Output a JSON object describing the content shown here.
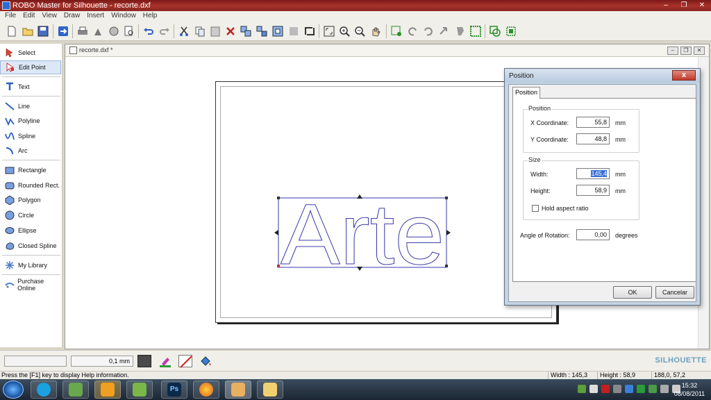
{
  "window": {
    "title": "ROBO Master for Silhouette - recorte.dxf",
    "controls": [
      "–",
      "❐",
      "✕"
    ]
  },
  "menu": [
    "File",
    "Edit",
    "View",
    "Draw",
    "Insert",
    "Window",
    "Help"
  ],
  "toolbox": [
    {
      "label": "Select",
      "icon": "select-arrow-icon"
    },
    {
      "label": "Edit Point",
      "icon": "edit-point-icon"
    },
    {
      "label": "Text",
      "icon": "text-icon"
    },
    {
      "label": "Line",
      "icon": "line-icon"
    },
    {
      "label": "Polyline",
      "icon": "polyline-icon"
    },
    {
      "label": "Spline",
      "icon": "spline-icon"
    },
    {
      "label": "Arc",
      "icon": "arc-icon"
    },
    {
      "label": "Rectangle",
      "icon": "rectangle-icon"
    },
    {
      "label": "Rounded Rect.",
      "icon": "rounded-rect-icon"
    },
    {
      "label": "Polygon",
      "icon": "polygon-icon"
    },
    {
      "label": "Circle",
      "icon": "circle-icon"
    },
    {
      "label": "Ellipse",
      "icon": "ellipse-icon"
    },
    {
      "label": "Closed Spline",
      "icon": "closed-spline-icon"
    },
    {
      "label": "My Library",
      "icon": "library-icon"
    },
    {
      "label": "Purchase Online",
      "icon": "purchase-icon"
    }
  ],
  "document": {
    "title": "recorte.dxf *",
    "artwork_text": "Arte"
  },
  "dialog": {
    "title": "Position",
    "close": "x",
    "tab": "Position",
    "position_group": "Position",
    "x_label": "X Coordinate:",
    "x_value": "55,8",
    "x_unit": "mm",
    "y_label": "Y Coordinate:",
    "y_value": "48,8",
    "y_unit": "mm",
    "size_group": "Size",
    "width_label": "Width:",
    "width_value": "145,4",
    "width_unit": "mm",
    "height_label": "Height:",
    "height_value": "58,9",
    "height_unit": "mm",
    "aspect_label": "Hold aspect ratio",
    "rotation_label": "Angle of Rotation:",
    "rotation_value": "0,00",
    "rotation_unit": "degrees",
    "ok": "OK",
    "cancel": "Cancelar"
  },
  "bottombar": {
    "line_width": "0,1 mm",
    "brand": "SILHOUETTE"
  },
  "status": {
    "message": "Press the [F1] key to display Help information.",
    "width": "Width : 145,3",
    "height": "Height : 58,9",
    "coords": "188,0, 57,2"
  },
  "taskbar": {
    "time": "15:32",
    "date": "08/08/2011",
    "apps": [
      "Skype",
      "People",
      "Outlook",
      "Evernote",
      "Ps",
      "Firefox",
      "ROBO Master",
      "Folder"
    ]
  },
  "colors": {
    "titlebar": "#8a2420",
    "selection": "#3a6fd8",
    "artwork_outline": "#3b3ba8"
  }
}
